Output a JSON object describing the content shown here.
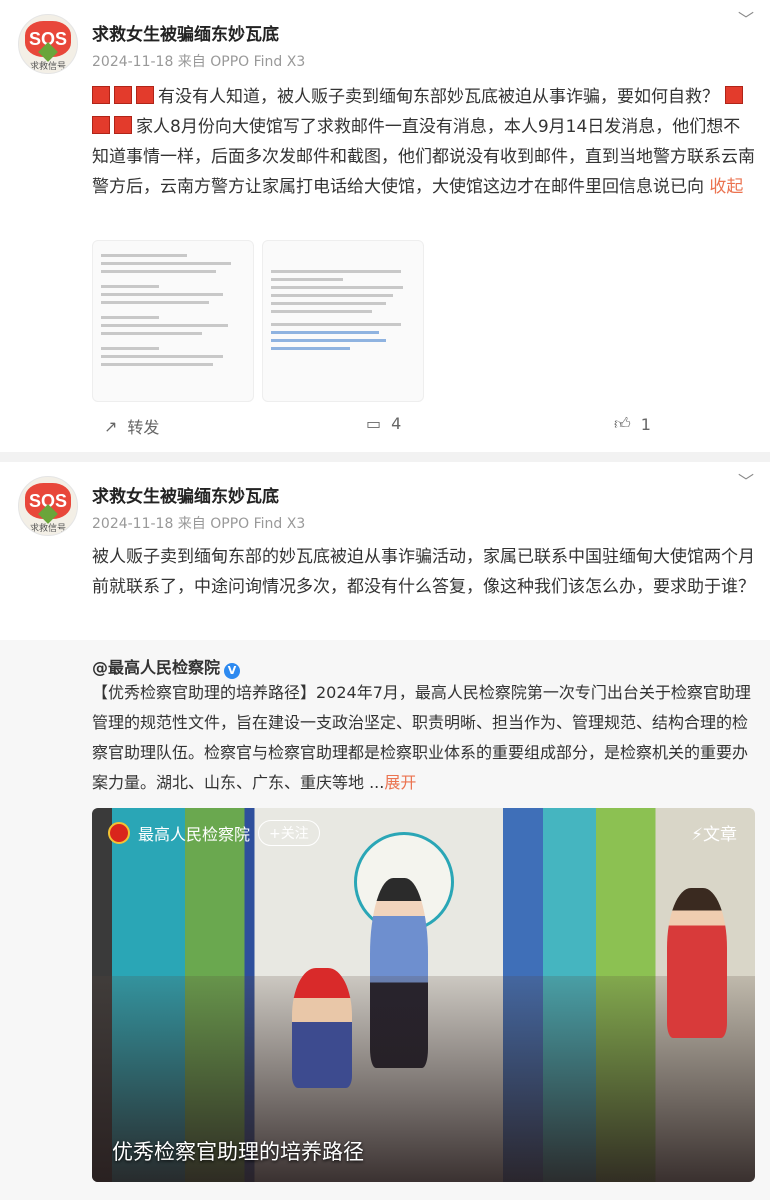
{
  "posts": [
    {
      "author": "求救女生被骗缅东妙瓦底",
      "avatar_text": "SOS",
      "avatar_caption": "求救信号",
      "meta": "2024-11-18 来自 OPPO Find X3",
      "text_a": "有没有人知道，被人贩子卖到缅甸东部妙瓦底被迫从事诈骗，要如何自救？",
      "text_b": "家人8月份向大使馆写了求救邮件一直没有消息，本人9月14日发消息，他们想不知道事情一样，后面多次发邮件和截图，他们都说没有收到邮件，直到当地警方联系云南警方后，云南方警方让家属打电话给大使馆，大使馆这边才在邮件里回信息说已向",
      "collapse": "收起",
      "sos_emoji": "SOS",
      "actions": {
        "repost": "转发",
        "comments": "4",
        "likes": "1"
      }
    },
    {
      "author": "求救女生被骗缅东妙瓦底",
      "avatar_text": "SOS",
      "avatar_caption": "求救信号",
      "meta": "2024-11-18 来自 OPPO Find X3",
      "text": "被人贩子卖到缅甸东部的妙瓦底被迫从事诈骗活动，家属已联系中国驻缅甸大使馆两个月前就联系了，中途问询情况多次，都没有什么答复，像这种我们该怎么办，要求助于谁？",
      "repost": {
        "author": "@最高人民检察院",
        "verified": "V",
        "text": "【优秀检察官助理的培养路径】2024年7月，最高人民检察院第一次专门出台关于检察官助理管理的规范性文件，旨在建设一支政治坚定、职责明晰、担当作为、管理规范、结构合理的检察官助理队伍。检察官与检察官助理都是检察职业体系的重要组成部分，是检察机关的重要办案力量。湖北、山东、广东、重庆等地 ...",
        "expand": "展开",
        "card": {
          "source": "最高人民检察院",
          "follow": "+关注",
          "tag": "⚡文章",
          "title": "优秀检察官助理的培养路径"
        }
      }
    }
  ],
  "icons": {
    "menu": "chevron-down-icon",
    "repost": "share-icon",
    "comment": "comment-icon",
    "like": "thumbs-up-icon"
  },
  "colors": {
    "accent": "#eb7350",
    "verified": "#2e8af0"
  }
}
